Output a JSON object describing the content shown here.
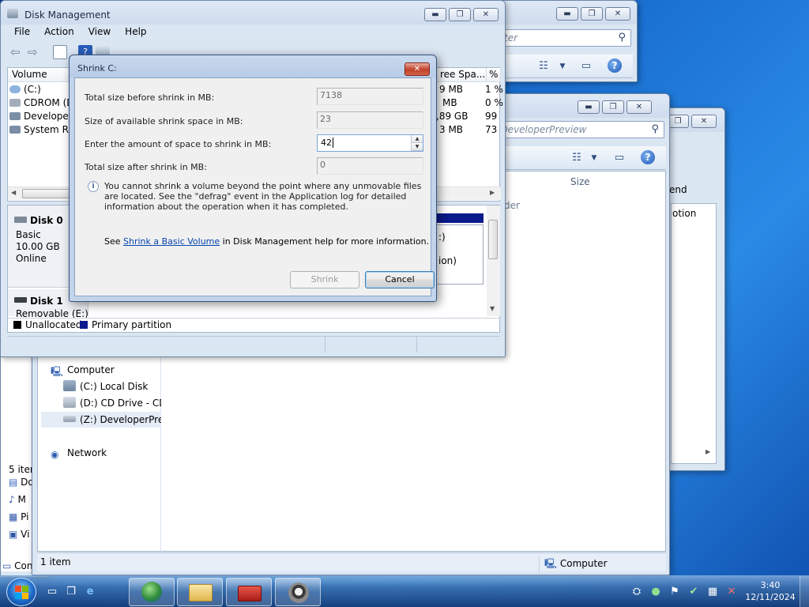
{
  "explorer_back": {
    "search_placeholder": "ter",
    "ctrl_min": "▬",
    "ctrl_max": "❐",
    "ctrl_close": "✕"
  },
  "explorer_front": {
    "search_placeholder": "(Z:) DeveloperPreview",
    "column_size": "Size",
    "column_partial": "der",
    "status_count": "1 item",
    "status_location": "Computer",
    "nav": {
      "computer": "Computer",
      "c_drive": "(C:) Local Disk",
      "d_drive": "(D:) CD Drive - CDR",
      "z_drive": "(Z:) DeveloperPrevi",
      "network": "Network"
    }
  },
  "explorer_right": {
    "label_end": "end",
    "label_option": "otion"
  },
  "left_partial": {
    "items_count": "5 item",
    "frag_1": "Do",
    "frag_2": "M",
    "frag_3": "Pi",
    "frag_4": "Vi",
    "frag_5": "Con"
  },
  "disk_management": {
    "title": "Disk Management",
    "menu": [
      "File",
      "Action",
      "View",
      "Help"
    ],
    "columns": {
      "volume": "Volume",
      "free_space": "ree Spa...",
      "pct_free": "% F"
    },
    "volumes": [
      {
        "name": "(C:)",
        "free": "9 MB",
        "pct": "1 %"
      },
      {
        "name": "CDROM (D",
        "free": "MB",
        "pct": "0 %"
      },
      {
        "name": "DeveloperF",
        "free": ",89 GB",
        "pct": "99"
      },
      {
        "name": "System Res",
        "free": "3 MB",
        "pct": "73"
      }
    ],
    "disk0": {
      "label": "Disk 0",
      "type": "Basic",
      "size": "10.00 GB",
      "status": "Online"
    },
    "disk1": {
      "label": "Disk 1",
      "type": "Removable (E:)"
    },
    "partition_frag_1": ":)",
    "partition_frag_2": "ion)",
    "legend": {
      "unallocated": "Unallocated",
      "primary": "Primary partition"
    }
  },
  "shrink_dialog": {
    "title": "Shrink C:",
    "rows": [
      {
        "label": "Total size before shrink in MB:",
        "value": "7138"
      },
      {
        "label": "Size of available shrink space in MB:",
        "value": "23"
      },
      {
        "label": "Enter the amount of space to shrink in MB:",
        "value": "42"
      },
      {
        "label": "Total size after shrink in MB:",
        "value": "0"
      }
    ],
    "info_text": "You cannot shrink a volume beyond the point where any unmovable files are located. See the \"defrag\" event in the Application log for detailed information about the operation when it has completed.",
    "help_prefix": "See ",
    "help_link": "Shrink a Basic Volume",
    "help_suffix": " in Disk Management help for more information.",
    "shrink_button": "Shrink",
    "cancel_button": "Cancel"
  },
  "taskbar": {
    "time": "3:40",
    "date": "12/11/2024"
  },
  "colors": {
    "accent": "#1f5fbf",
    "primary_partition": "#0b1a8c",
    "unallocated": "#000000",
    "link": "#0645ad"
  }
}
